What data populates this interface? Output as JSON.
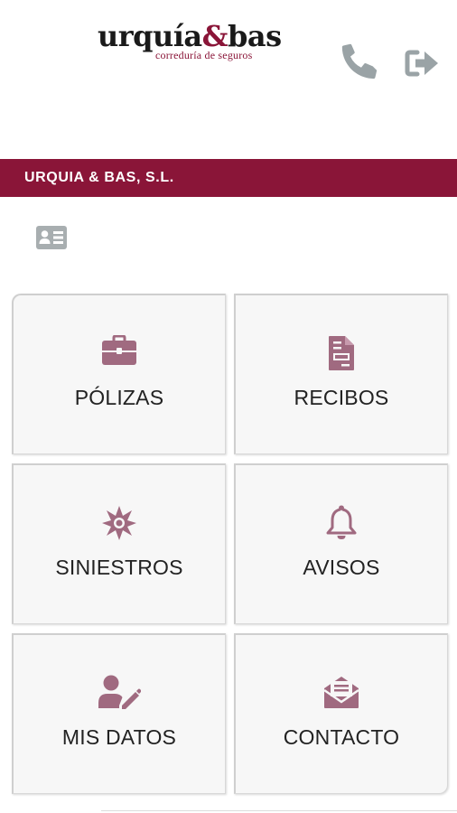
{
  "logo": {
    "main_prefix": "urquía",
    "amp": "&",
    "main_suffix": "bas",
    "tagline": "correduría de seguros"
  },
  "banner": {
    "company": "URQUIA & BAS, S.L."
  },
  "colors": {
    "brand": "#8a1538",
    "icon": "#a06a80",
    "top_icon": "#9aa3a6",
    "tile_bg": "#f7f7f7"
  },
  "menu": [
    {
      "label": "PÓLIZAS",
      "icon": "briefcase-icon"
    },
    {
      "label": "RECIBOS",
      "icon": "document-icon"
    },
    {
      "label": "SINIESTROS",
      "icon": "burst-icon"
    },
    {
      "label": "AVISOS",
      "icon": "bell-icon"
    },
    {
      "label": "MIS DATOS",
      "icon": "user-edit-icon"
    },
    {
      "label": "CONTACTO",
      "icon": "open-envelope-icon"
    }
  ]
}
